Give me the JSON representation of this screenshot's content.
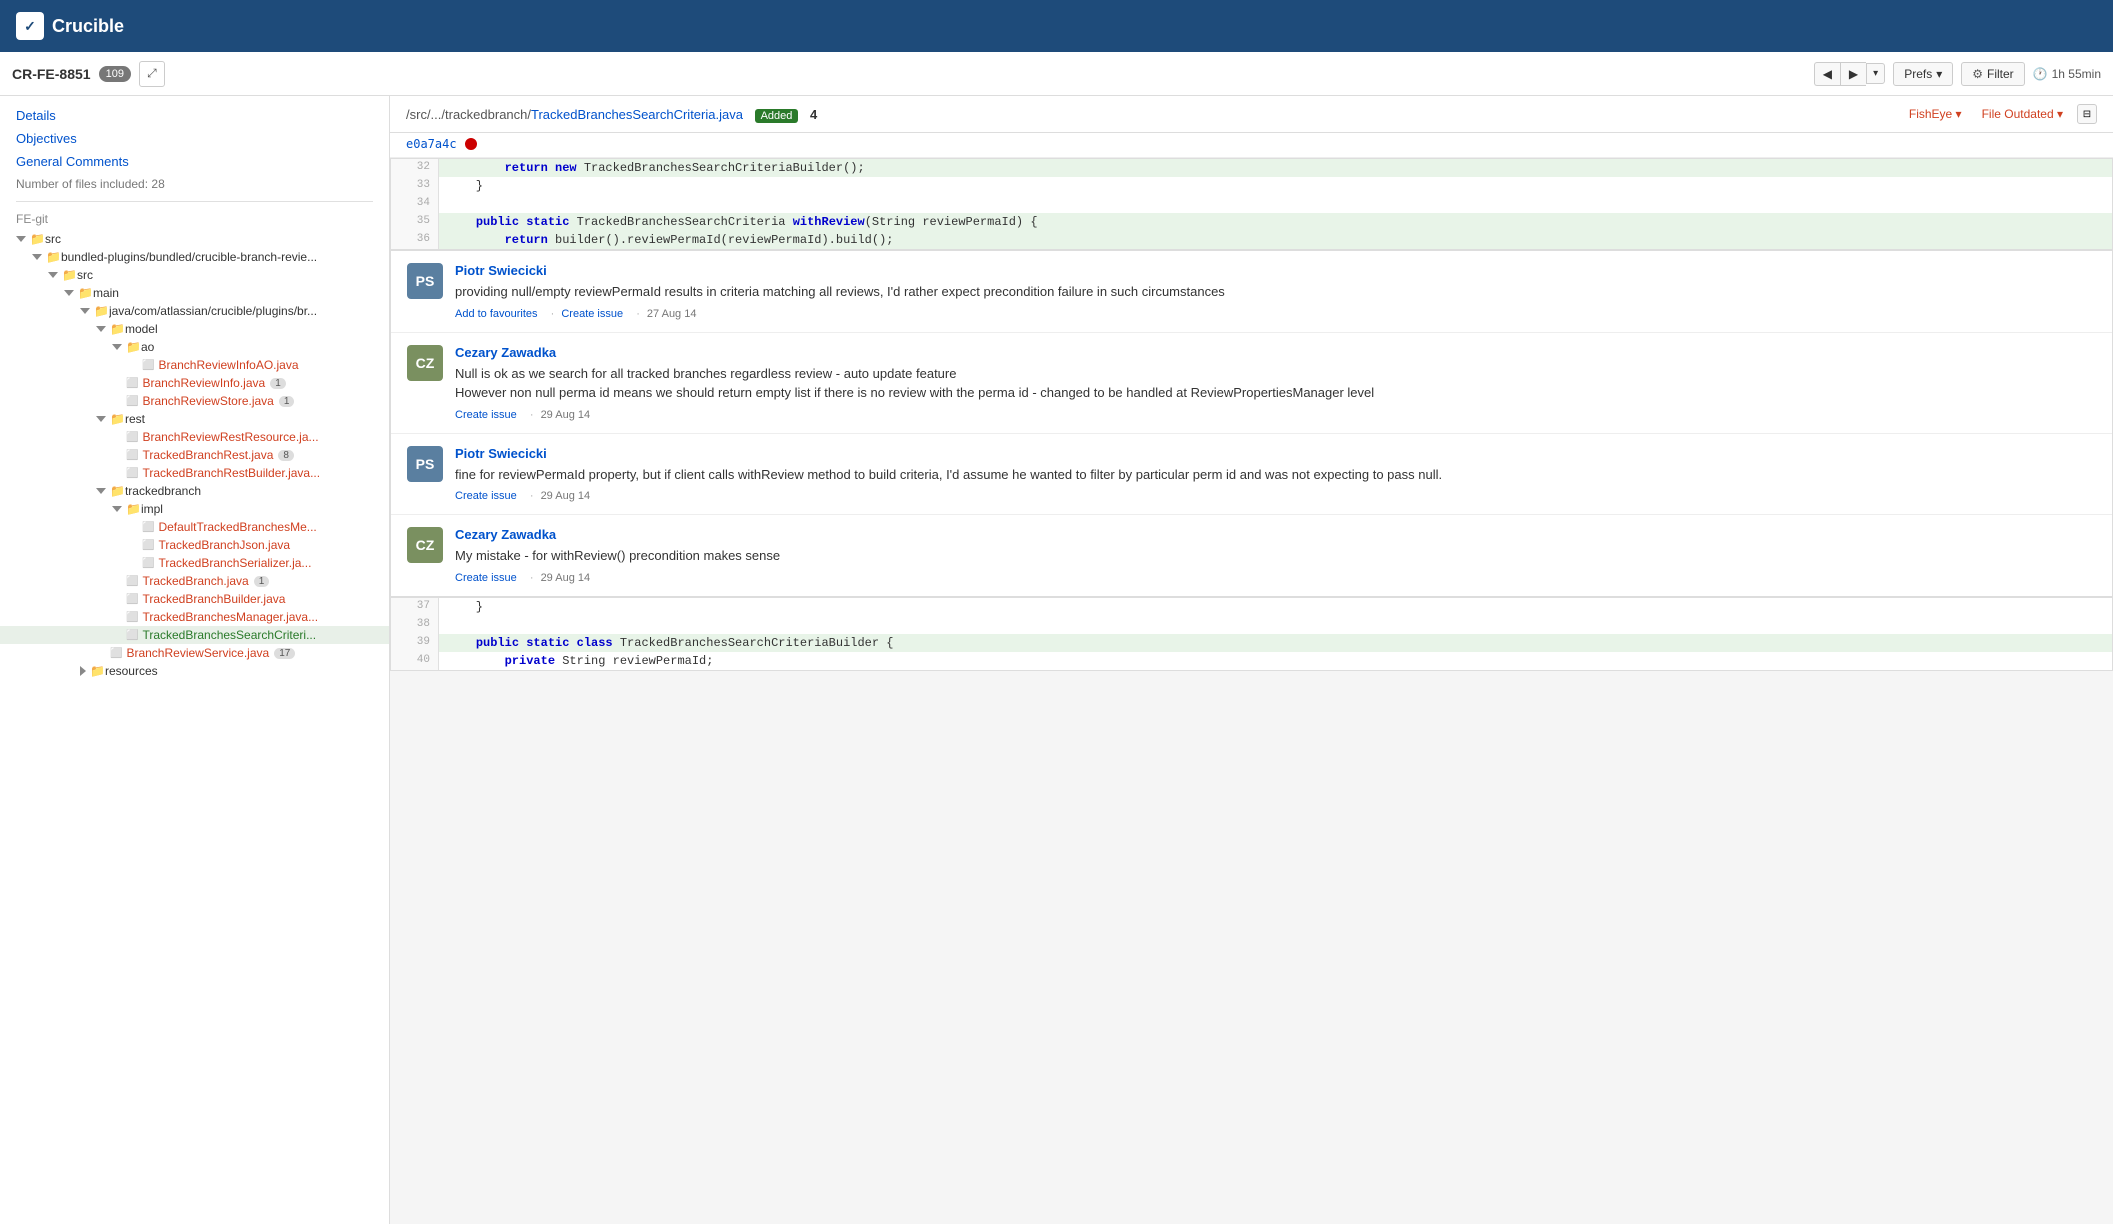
{
  "app": {
    "logo": "Crucible",
    "logo_icon": "✓"
  },
  "subheader": {
    "cr_id": "CR-FE-8851",
    "badge_count": "109",
    "toolbar": {
      "prev_label": "◀",
      "next_label": "▶",
      "prefs_label": "Prefs",
      "filter_label": "Filter",
      "time_label": "1h 55min"
    }
  },
  "left_panel": {
    "nav_links": [
      "Details",
      "Objectives",
      "General Comments"
    ],
    "file_count": "Number of files included: 28",
    "section": "FE-git",
    "tree": [
      {
        "label": "src",
        "type": "folder",
        "indent": 1,
        "expanded": true
      },
      {
        "label": "bundled-plugins/bundled/crucible-branch-revie...",
        "type": "folder",
        "indent": 2,
        "expanded": true
      },
      {
        "label": "src",
        "type": "folder",
        "indent": 3,
        "expanded": true
      },
      {
        "label": "main",
        "type": "folder",
        "indent": 4,
        "expanded": true
      },
      {
        "label": "java/com/atlassian/crucible/plugins/br...",
        "type": "folder",
        "indent": 5,
        "expanded": true
      },
      {
        "label": "model",
        "type": "folder",
        "indent": 6,
        "expanded": true
      },
      {
        "label": "ao",
        "type": "folder",
        "indent": 7,
        "expanded": true
      },
      {
        "label": "BranchReviewInfoAO.java",
        "type": "file_modified",
        "indent": 8
      },
      {
        "label": "BranchReviewInfo.java",
        "type": "file_modified",
        "indent": 7,
        "count": "1"
      },
      {
        "label": "BranchReviewStore.java",
        "type": "file_modified",
        "indent": 7,
        "count": "1"
      },
      {
        "label": "rest",
        "type": "folder",
        "indent": 6,
        "expanded": true
      },
      {
        "label": "BranchReviewRestResource.ja...",
        "type": "file_modified",
        "indent": 7
      },
      {
        "label": "TrackedBranchRest.java",
        "type": "file_modified",
        "indent": 7,
        "count": "8"
      },
      {
        "label": "TrackedBranchRestBuilder.java",
        "type": "file_modified",
        "indent": 7
      },
      {
        "label": "trackedbranch",
        "type": "folder",
        "indent": 6,
        "expanded": true
      },
      {
        "label": "impl",
        "type": "folder",
        "indent": 7,
        "expanded": true
      },
      {
        "label": "DefaultTrackedBranchesMe...",
        "type": "file_modified",
        "indent": 8
      },
      {
        "label": "TrackedBranchJson.java",
        "type": "file_modified",
        "indent": 8
      },
      {
        "label": "TrackedBranchSerializer.ja...",
        "type": "file_modified",
        "indent": 8
      },
      {
        "label": "TrackedBranch.java",
        "type": "file_modified",
        "indent": 7,
        "count": "1"
      },
      {
        "label": "TrackedBranchBuilder.java",
        "type": "file_modified",
        "indent": 7
      },
      {
        "label": "TrackedBranchesManager.java...",
        "type": "file_modified",
        "indent": 7
      },
      {
        "label": "TrackedBranchesSearchCriteri...",
        "type": "file_green",
        "indent": 7
      },
      {
        "label": "BranchReviewService.java",
        "type": "file_modified",
        "indent": 6,
        "count": "17"
      },
      {
        "label": "resources",
        "type": "folder",
        "indent": 5,
        "expanded": false
      }
    ]
  },
  "right_panel": {
    "file_path_prefix": "/src/.../trackedbranch/",
    "file_name": "TrackedBranchesSearchCriteria.java",
    "file_status": "Added",
    "file_comment_count": "4",
    "fisheye_label": "FishEye ▾",
    "outdated_label": "File Outdated ▾",
    "commit_hash": "e0a7a4c",
    "code_lines": [
      {
        "num": "32",
        "content": "        return new TrackedBranchesSearchCriteriaBuilder();",
        "highlight": true
      },
      {
        "num": "33",
        "content": "    }",
        "highlight": false
      },
      {
        "num": "34",
        "content": "",
        "highlight": false
      },
      {
        "num": "35",
        "content": "    public static TrackedBranchesSearchCriteria withReview(String reviewPermaId) {",
        "highlight": true
      },
      {
        "num": "36",
        "content": "        return builder().reviewPermaId(reviewPermaId).build();",
        "highlight": true
      }
    ],
    "comments": [
      {
        "author": "Piotr Swiecicki",
        "avatar_initials": "PS",
        "avatar_class": "avatar-ps",
        "text": "providing null/empty reviewPermaId results in criteria matching all reviews, I'd rather expect precondition failure in such circumstances",
        "actions_text": "Add to favourites · Create issue · 27 Aug 14"
      },
      {
        "author": "Cezary Zawadka",
        "avatar_initials": "CZ",
        "avatar_class": "avatar-cz",
        "text": "Null is ok as we search for all tracked branches regardless review - auto update feature\nHowever non null perma id means we should return empty list if there is no review with the perma id - changed to be handled at ReviewPropertiesManager level",
        "actions_text": "Create issue · 29 Aug 14"
      },
      {
        "author": "Piotr Swiecicki",
        "avatar_initials": "PS",
        "avatar_class": "avatar-ps",
        "text": "fine for reviewPermaId property, but if client calls withReview method to build criteria, I'd assume he wanted to filter by particular perm id and was not expecting to pass null.",
        "actions_text": "Create issue · 29 Aug 14"
      },
      {
        "author": "Cezary Zawadka",
        "avatar_initials": "CZ",
        "avatar_class": "avatar-cz",
        "text": "My mistake - for withReview() precondition makes sense",
        "actions_text": "Create issue · 29 Aug 14"
      }
    ],
    "code_lines_bottom": [
      {
        "num": "37",
        "content": "    }",
        "highlight": false
      },
      {
        "num": "38",
        "content": "",
        "highlight": false
      },
      {
        "num": "39",
        "content": "    public static class TrackedBranchesSearchCriteriaBuilder {",
        "highlight": true
      },
      {
        "num": "40",
        "content": "        private String reviewPermaId;",
        "highlight": false
      }
    ]
  }
}
